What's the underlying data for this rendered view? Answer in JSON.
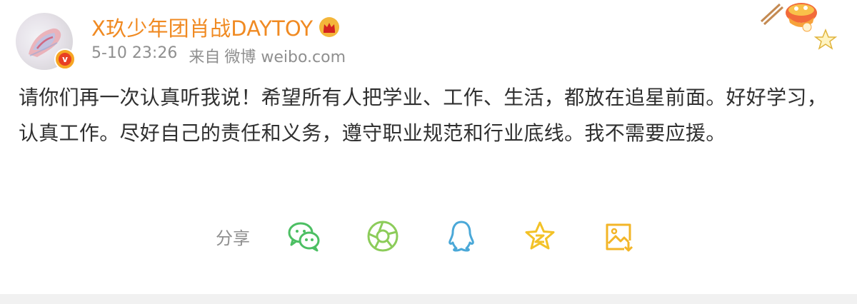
{
  "post": {
    "author": "X玖少年团肖战DAYTOY",
    "timestamp": "5-10 23:26",
    "source_prefix": "来自",
    "source": "微博 weibo.com",
    "text": "请你们再一次认真听我说！希望所有人把学业、工作、生活，都放在追星前面。好好学习，认真工作。尽好自己的责任和义务，遵守职业规范和行业底线。我不需要应援。"
  },
  "share": {
    "label": "分享",
    "targets": [
      {
        "icon": "wechat-icon",
        "color": "#4cbf63"
      },
      {
        "icon": "moments-icon",
        "color": "#8ccc5a"
      },
      {
        "icon": "qq-icon",
        "color": "#4aa8d8"
      },
      {
        "icon": "qzone-icon",
        "color": "#f3c227"
      },
      {
        "icon": "save-image-icon",
        "color": "#f3b527"
      }
    ]
  },
  "colors": {
    "username": "#f08a22",
    "meta": "#8f8f8f",
    "body": "#303030",
    "verify_outer": "#f6a623",
    "verify_inner": "#e83f23"
  }
}
